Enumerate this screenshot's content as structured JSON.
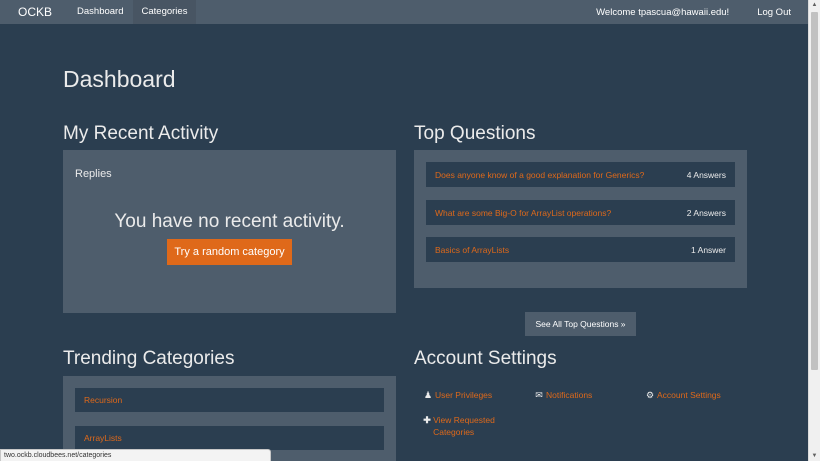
{
  "nav": {
    "brand": "OCKB",
    "links": [
      "Dashboard",
      "Categories"
    ],
    "welcome": "Welcome tpascua@hawaii.edu!",
    "logout": "Log Out"
  },
  "page_title": "Dashboard",
  "recent_activity": {
    "title": "My Recent Activity",
    "replies_label": "Replies",
    "empty_message": "You have no recent activity.",
    "button_label": "Try a random category"
  },
  "top_questions": {
    "title": "Top Questions",
    "items": [
      {
        "question": "Does anyone know of a good explanation for Generics?",
        "answers": "4 Answers"
      },
      {
        "question": "What are some Big-O for ArrayList operations?",
        "answers": "2 Answers"
      },
      {
        "question": "Basics of ArrayLists",
        "answers": "1 Answer"
      }
    ],
    "see_all_label": "See All Top Questions »"
  },
  "trending": {
    "title": "Trending Categories",
    "items": [
      "Recursion",
      "ArrayLists"
    ]
  },
  "account": {
    "title": "Account Settings",
    "links": {
      "privileges": "User Privileges",
      "notifications": "Notifications",
      "settings": "Account Settings",
      "view_requested": "View Requested Categories"
    },
    "icons": {
      "privileges": "user-icon",
      "notifications": "envelope-icon",
      "settings": "gear-icon",
      "view_requested": "plus-icon"
    }
  },
  "statusbar": {
    "url": "two.ockb.cloudbees.net/categories"
  },
  "colors": {
    "background": "#2b3e50",
    "panel": "#4e5d6c",
    "accent": "#df691a"
  }
}
